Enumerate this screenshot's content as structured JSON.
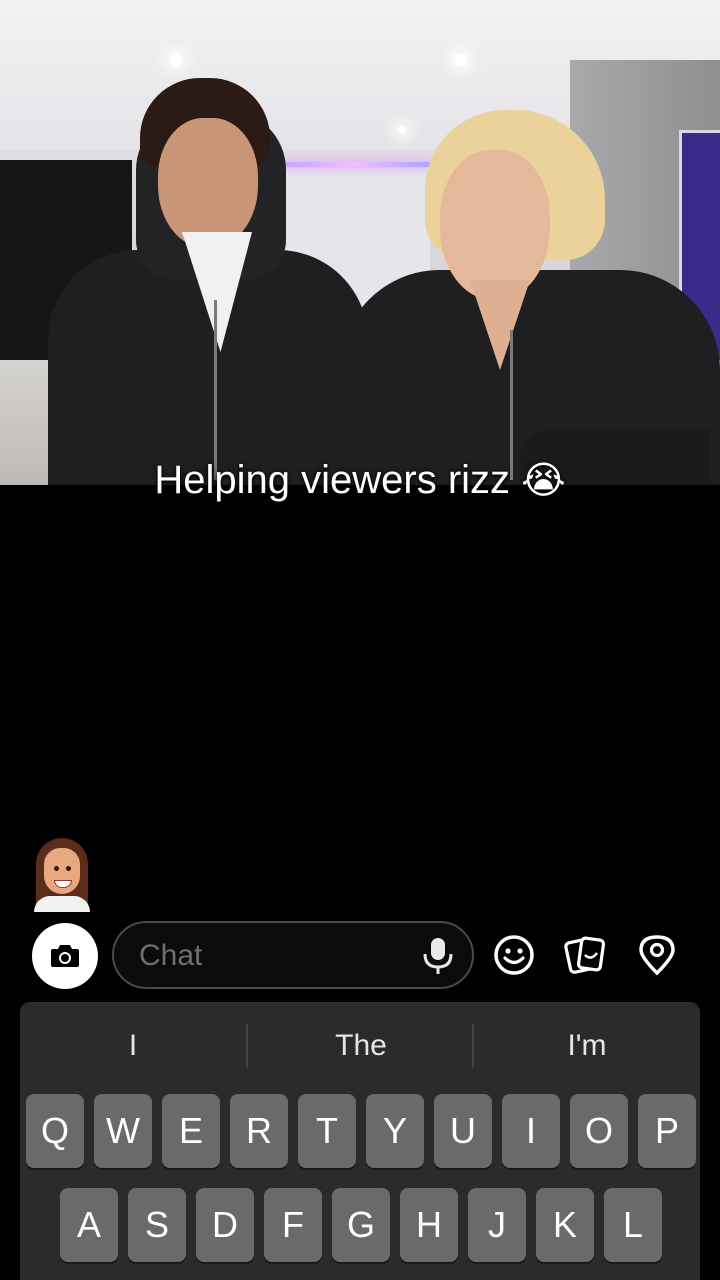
{
  "video": {
    "caption_text": "Helping viewers rizz",
    "caption_emoji": "😭"
  },
  "chat_bar": {
    "placeholder": "Chat",
    "camera_icon": "camera-icon",
    "mic_icon": "microphone-icon",
    "emoji_icon": "smiley-icon",
    "stickers_icon": "stickers-icon",
    "location_icon": "location-pin-icon"
  },
  "keyboard": {
    "suggestions": [
      "I",
      "The",
      "I'm"
    ],
    "row1": [
      "Q",
      "W",
      "E",
      "R",
      "T",
      "Y",
      "U",
      "I",
      "O",
      "P"
    ],
    "row2": [
      "A",
      "S",
      "D",
      "F",
      "G",
      "H",
      "J",
      "K",
      "L"
    ]
  },
  "colors": {
    "background": "#000000",
    "keyboard_bg": "#2b2b2d",
    "key_bg": "#6a6a6d",
    "input_border": "#4a4a4e",
    "placeholder": "#6e6e73"
  }
}
